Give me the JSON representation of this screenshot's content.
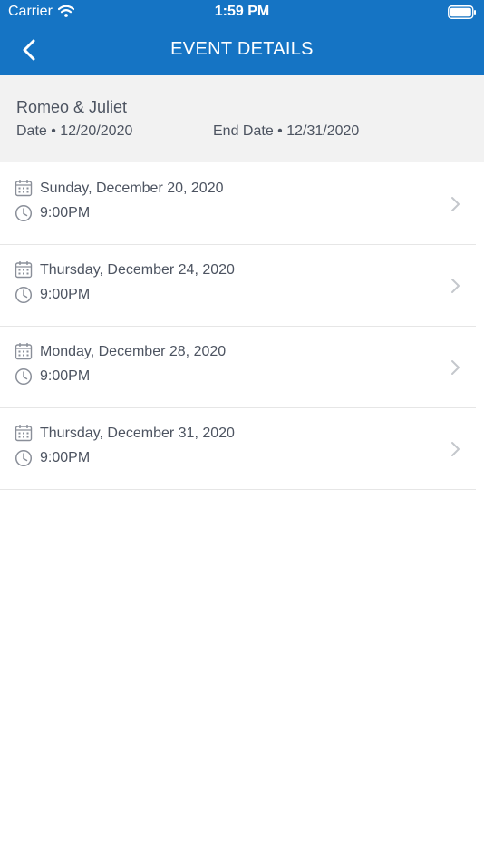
{
  "status_bar": {
    "carrier": "Carrier",
    "time": "1:59 PM",
    "wifi_icon": "wifi-icon",
    "battery_icon": "battery-icon"
  },
  "nav": {
    "title": "EVENT DETAILS",
    "back_icon": "chevron-left-icon",
    "background_color": "#1574c4",
    "text_color": "#ffffff"
  },
  "event": {
    "name": "Romeo & Juliet",
    "start_date": "Date • 12/20/2020",
    "end_date": "End Date • 12/31/2020"
  },
  "showtimes": [
    {
      "date": "Sunday, December 20, 2020",
      "time": "9:00PM"
    },
    {
      "date": "Thursday, December 24, 2020",
      "time": "9:00PM"
    },
    {
      "date": "Monday, December 28, 2020",
      "time": "9:00PM"
    },
    {
      "date": "Thursday, December 31, 2020",
      "time": "9:00PM"
    }
  ],
  "icons": {
    "calendar": "calendar-icon",
    "clock": "clock-icon",
    "row_chevron": "chevron-right-icon"
  }
}
